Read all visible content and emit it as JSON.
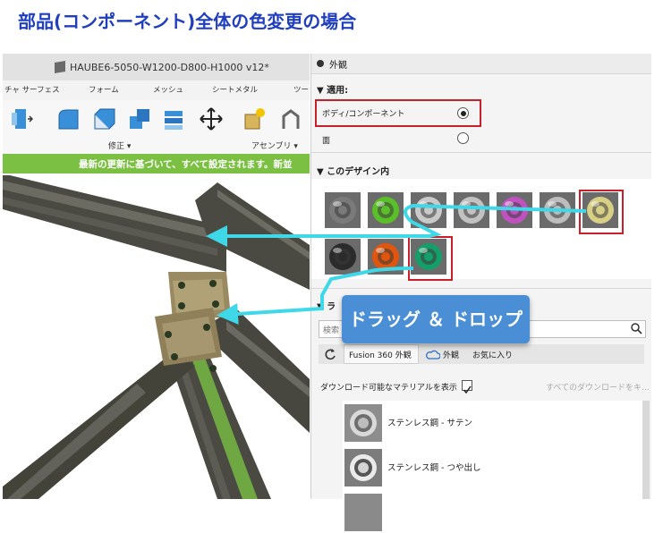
{
  "slide": {
    "title": "部品(コンポーネント)全体の色変更の場合"
  },
  "fusion": {
    "doc_title": "HAUBE6-5050-W1200-D800-H1000 v12*",
    "tabs": [
      "チャ サーフェス",
      "フォーム",
      "メッシュ",
      "シートメタル",
      "ツー"
    ],
    "ribbon": {
      "modify_label": "修正 ▾",
      "assembly_label": "アセンブリ ▾"
    },
    "banner": "最新の更新に基づいて、すべて設定されます。新並"
  },
  "panel": {
    "title": "外観",
    "apply_section": "▼ 適用:",
    "options": [
      {
        "label": "ボディ/コンポーネント",
        "selected": true
      },
      {
        "label": "面",
        "selected": false
      }
    ],
    "design_section": "▼ このデザイン内",
    "swatches": [
      {
        "name": "swatch-gray",
        "color": "#7a7a7a"
      },
      {
        "name": "swatch-green",
        "color": "#5bbf2a"
      },
      {
        "name": "swatch-silver",
        "color": "#c9c9c9"
      },
      {
        "name": "swatch-silver-2",
        "color": "#c2c2c2"
      },
      {
        "name": "swatch-purple",
        "color": "#c052c0"
      },
      {
        "name": "swatch-silver-3",
        "color": "#bdbdbd"
      },
      {
        "name": "swatch-gold",
        "color": "#d8cf86"
      },
      {
        "name": "swatch-black",
        "color": "#2b2b2b"
      },
      {
        "name": "swatch-orange",
        "color": "#e0560f"
      },
      {
        "name": "swatch-teal",
        "color": "#159e6a"
      }
    ],
    "library_section": "▼ ラ",
    "search_placeholder": "検索",
    "library_tabs": {
      "fusion": "Fusion 360 外観",
      "cloud": "外観",
      "favorites": "お気に入り"
    },
    "show_downloadable": "ダウンロード可能なマテリアルを表示",
    "download_all": "すべてのダウンロードをキ...",
    "materials": [
      "ステンレス鋼 - サテン",
      "ステンレス鋼 - つや出し"
    ]
  },
  "callout": {
    "text": "ドラッグ ＆ ドロップ"
  }
}
